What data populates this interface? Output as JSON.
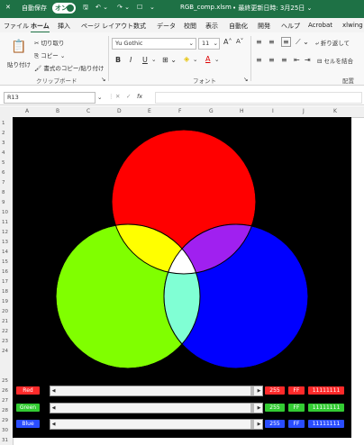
{
  "titlebar": {
    "autosave_label": "自動保存",
    "autosave_state": "オン",
    "filename": "RGB_comp.xlsm",
    "saved_status": "• 最終更新日時: 3月25日 ⌄"
  },
  "menu": {
    "items": [
      "ファイル",
      "ホーム",
      "挿入",
      "ページ レイアウト",
      "数式",
      "データ",
      "校閲",
      "表示",
      "自動化",
      "開発",
      "ヘルプ",
      "Acrobat",
      "xlwing"
    ],
    "active": "ホーム"
  },
  "ribbon": {
    "paste_label": "貼り付け",
    "cut_label": "切り取り",
    "copy_label": "コピー",
    "format_painter_label": "書式のコピー/貼り付け",
    "clipboard_group": "クリップボード",
    "font_name": "Yu Gothic",
    "font_size": "11",
    "font_group": "フォント",
    "bold": "B",
    "italic": "I",
    "underline": "U",
    "wrap_text": "折り返して",
    "merge_center": "セルを結合",
    "align_group": "配置"
  },
  "formula_bar": {
    "name_box": "R13",
    "fx": "fx",
    "formula": ""
  },
  "columns": [
    "A",
    "B",
    "C",
    "D",
    "E",
    "F",
    "G",
    "H",
    "I",
    "J",
    "K"
  ],
  "rows": [
    "1",
    "2",
    "3",
    "4",
    "5",
    "6",
    "7",
    "8",
    "9",
    "10",
    "11",
    "12",
    "13",
    "14",
    "15",
    "16",
    "17",
    "18",
    "19",
    "20",
    "21",
    "22",
    "23",
    "24",
    "25",
    "26",
    "27",
    "28",
    "29",
    "30",
    "31",
    "32"
  ],
  "colors": {
    "red": "#ff0000",
    "green": "#80ff00",
    "blue": "#0000ff",
    "yellow": "#ffff00",
    "magenta": "#a020f0",
    "cyan": "#80ffd4",
    "center": "#ffffff",
    "canvas": "#000000"
  },
  "controls": [
    {
      "label": "Red",
      "dec": "255",
      "hex": "FF",
      "bin": "11111111",
      "color": "#ff2a2a"
    },
    {
      "label": "Green",
      "dec": "255",
      "hex": "FF",
      "bin": "11111111",
      "color": "#33cc33"
    },
    {
      "label": "Blue",
      "dec": "255",
      "hex": "FF",
      "bin": "11111111",
      "color": "#2a4dff"
    }
  ]
}
